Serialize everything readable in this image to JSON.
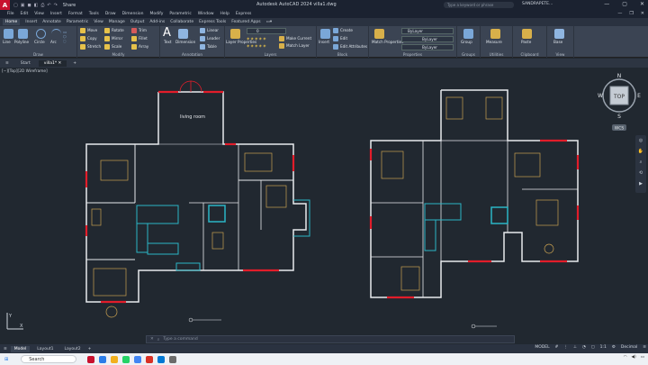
{
  "app": {
    "title": "Autodesk AutoCAD 2024  villa1.dwg",
    "logo": "A",
    "share": "Share",
    "search_placeholder": "Type a keyword or phrase",
    "user": "SANDRAPETE...",
    "quick_access": [
      "new-icon",
      "open-icon",
      "save-icon",
      "saveas-icon",
      "print-icon",
      "undo-icon",
      "redo-icon"
    ]
  },
  "menu": [
    "File",
    "Edit",
    "View",
    "Insert",
    "Format",
    "Tools",
    "Draw",
    "Dimension",
    "Modify",
    "Parametric",
    "Window",
    "Help",
    "Express"
  ],
  "ribbon_tabs": [
    "Home",
    "Insert",
    "Annotate",
    "Parametric",
    "View",
    "Manage",
    "Output",
    "Add-ins",
    "Collaborate",
    "Express Tools",
    "Featured Apps"
  ],
  "ribbon": {
    "draw": {
      "title": "Draw",
      "items": [
        "Line",
        "Polyline",
        "Circle",
        "Arc"
      ]
    },
    "modify": {
      "title": "Modify",
      "items": [
        "Move",
        "Rotate",
        "Trim",
        "Copy",
        "Mirror",
        "Fillet",
        "Stretch",
        "Scale",
        "Array"
      ]
    },
    "annotation": {
      "title": "Annotation",
      "items": [
        "Text",
        "Dimension",
        "Linear",
        "Leader",
        "Table"
      ]
    },
    "layers": {
      "title": "Layers",
      "items": [
        "Layer Properties",
        "Make Current",
        "Match Layer"
      ],
      "current": "0"
    },
    "block": {
      "title": "Block",
      "items": [
        "Insert",
        "Create",
        "Edit",
        "Edit Attributes"
      ]
    },
    "properties": {
      "title": "Properties",
      "items": [
        "Match Properties"
      ],
      "values": [
        "ByLayer",
        "ByLayer",
        "ByLayer"
      ]
    },
    "groups": {
      "title": "Groups",
      "items": [
        "Group"
      ]
    },
    "utilities": {
      "title": "Utilities",
      "items": [
        "Measure"
      ]
    },
    "clipboard": {
      "title": "Clipboard",
      "items": [
        "Paste"
      ]
    },
    "view": {
      "title": "View",
      "items": [
        "Base"
      ]
    }
  },
  "file_tabs": [
    "Start",
    "villa1*"
  ],
  "viewport_label": "[−][Top][2D Wireframe]",
  "plan_labels": {
    "living_room": "living room"
  },
  "viewcube": {
    "n": "N",
    "s": "S",
    "e": "E",
    "w": "W",
    "face": "TOP",
    "wcs": "WCS"
  },
  "command_placeholder": "Type a command",
  "layout_tabs": [
    "Model",
    "Layout1",
    "Layout2"
  ],
  "status": {
    "model": "MODEL",
    "scale": "1:1",
    "units": "Decimal"
  },
  "taskbar": {
    "search": "Search"
  },
  "colors": {
    "wall": "#e8eaee",
    "door_red": "#e21d2a",
    "stair_cyan": "#2bb6c6",
    "furniture": "#c8a050",
    "accent": "#c8102e"
  }
}
